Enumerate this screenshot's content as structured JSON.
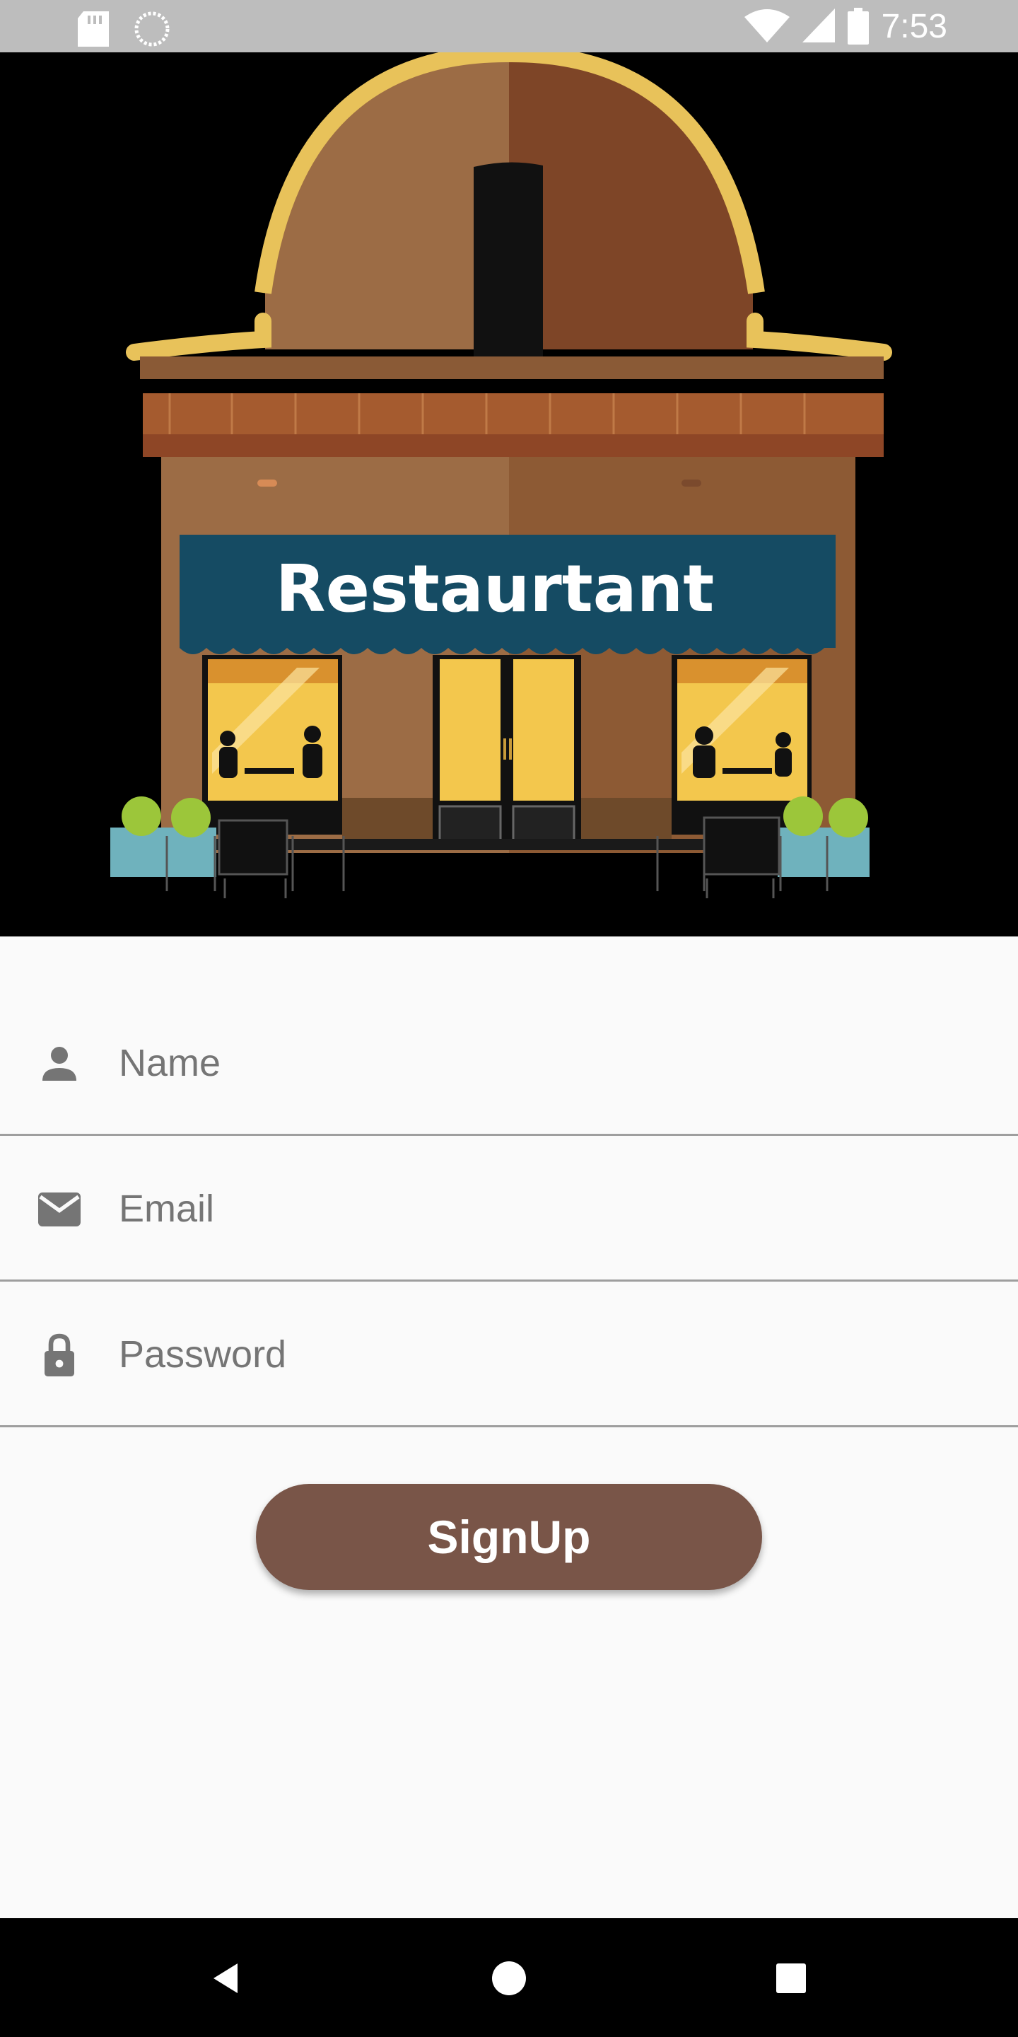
{
  "status_bar": {
    "time": "7:53",
    "icons": [
      "sd-card-icon",
      "sync-icon",
      "wifi-icon",
      "signal-icon",
      "battery-icon"
    ]
  },
  "hero": {
    "sign_text": "Restaurtant",
    "image_name": "restaurant-storefront-illustration"
  },
  "form": {
    "name": {
      "placeholder": "Name",
      "icon": "person-icon"
    },
    "email": {
      "placeholder": "Email",
      "icon": "mail-icon"
    },
    "password": {
      "placeholder": "Password",
      "icon": "lock-icon"
    },
    "signup_label": "SignUp"
  },
  "colors": {
    "button": "#795548",
    "awning": "#154b63",
    "roof_trim": "#e8c25a",
    "status_bar": "#bdbdbd"
  },
  "nav_bar": {
    "buttons": [
      "back-icon",
      "home-icon",
      "recents-icon"
    ]
  }
}
